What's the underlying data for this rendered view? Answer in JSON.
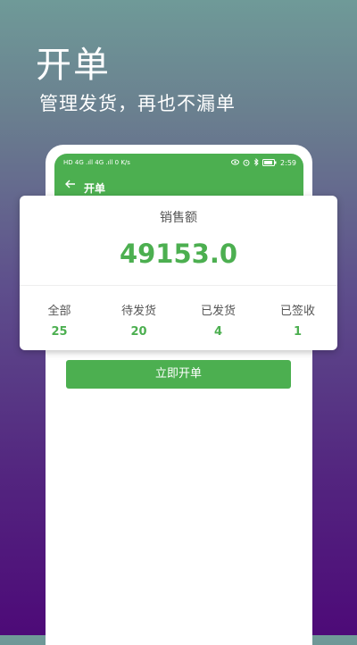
{
  "hero": {
    "title": "开单",
    "subtitle": "管理发货，再也不漏单"
  },
  "status_bar": {
    "left_text": "HD 4G .ıll 4G .ıll  0 K/s",
    "time": "2:59",
    "battery": "84",
    "icons": [
      "eye-icon",
      "alarm-icon",
      "bluetooth-icon",
      "battery-icon"
    ]
  },
  "nav": {
    "back_icon": "arrow-left-icon",
    "title": "开单"
  },
  "summary": {
    "label": "销售额",
    "amount": "49153.0"
  },
  "stats": [
    {
      "label": "全部",
      "value": "25"
    },
    {
      "label": "待发货",
      "value": "20"
    },
    {
      "label": "已发货",
      "value": "4"
    },
    {
      "label": "已签收",
      "value": "1"
    }
  ],
  "action": {
    "label": "立即开单"
  },
  "colors": {
    "accent": "#4caf50",
    "gradient_top": "#6f9a98",
    "gradient_bottom": "#4d0a78"
  }
}
